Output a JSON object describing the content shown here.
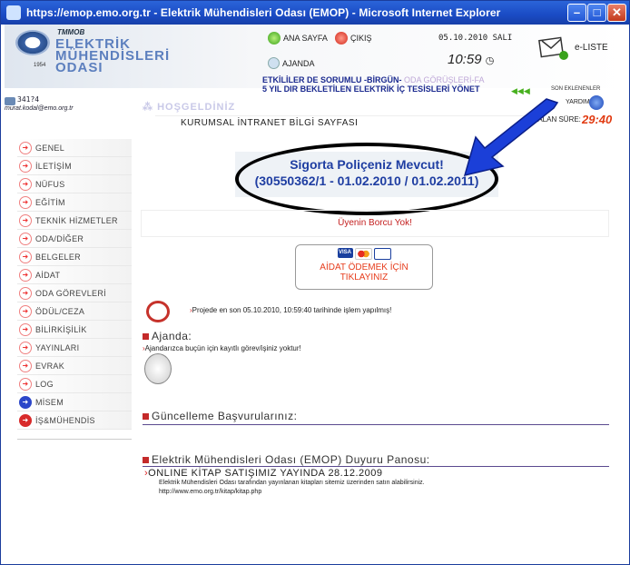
{
  "window": {
    "title": "https://emop.emo.org.tr - Elektrik Mühendisleri Odası (EMOP) - Microsoft Internet Explorer",
    "buttons": {
      "minimize": "–",
      "maximize": "□",
      "close": "✕"
    }
  },
  "header": {
    "logo": {
      "top": "TMMOB",
      "line1": "ELEKTRİK",
      "line2": "MÜHENDİSLERİ",
      "line3": "ODASI",
      "year": "1954"
    },
    "nav": {
      "home": "ANA SAYFA",
      "logout": "ÇIKIŞ",
      "agenda": "AJANDA"
    },
    "date": "05.10.2010 SALI",
    "time": "10:59",
    "eliste": "e-LISTE"
  },
  "user": {
    "id": "341?4",
    "email": "murat.kodal@emo.org.tr"
  },
  "ticker": {
    "line1": "ETKİLİLER DE SORUMLU -BİRGÜN-",
    "line1_faded": "ODA GÖRÜŞLERİ-FA",
    "line2": "5 YIL DIR BEKLETİLEN ELEKTRİK İÇ TESİSLERİ YÖNET"
  },
  "son_eklenenler": "SON EKLENENLER",
  "yardim": "YARDIM",
  "welcome": "HOŞGELDİNİZ",
  "intranet_title": "KURUMSAL İNTRANET BİLGİ SAYFASI",
  "kalan_sure": {
    "label": "KALAN SÜRE:",
    "value": "29:40"
  },
  "sidebar": {
    "items": [
      {
        "label": "GENEL"
      },
      {
        "label": "İLETİŞİM"
      },
      {
        "label": "NÜFUS"
      },
      {
        "label": "EĞİTİM"
      },
      {
        "label": "TEKNİK HİZMETLER"
      },
      {
        "label": "ODA/DİĞER"
      },
      {
        "label": "BELGELER"
      },
      {
        "label": "AİDAT"
      },
      {
        "label": "ODA GÖREVLERİ"
      },
      {
        "label": "ÖDÜL/CEZA"
      },
      {
        "label": "BİLİRKİŞİLİK"
      },
      {
        "label": "YAYINLARI"
      },
      {
        "label": "EVRAK"
      },
      {
        "label": "LOG"
      },
      {
        "label": "MİSEM"
      },
      {
        "label": "İŞ&MÜHENDİS"
      }
    ]
  },
  "policy": {
    "line1": "Sigorta Poliçeniz Mevcut!",
    "line2": "(30550362/1 - 01.02.2010 / 01.02.2011)"
  },
  "borcu": "Üyenin Borcu Yok!",
  "aidat_button": {
    "line1": "AİDAT ÖDEMEK İÇİN",
    "line2": "TIKLAYINIZ",
    "card1": "VISA"
  },
  "project_note": "Projede en son 05.10.2010, 10:59:40 tarihinde işlem yapılmış!",
  "ajanda": {
    "title": "Ajanda:",
    "note": "Ajandarızca buçün için kayıtlı görev/işiniz yoktur!"
  },
  "guncelleme": {
    "title": "Güncelleme Başvurularınız:"
  },
  "duyuru": {
    "title": "Elektrik Mühendisleri Odası (EMOP) Duyuru Panosu:",
    "item_title": "ONLINE KİTAP SATIŞIMIZ YAYINDA 28.12.2009",
    "item_body": "Elektrik Mühendisleri Odası tarafından yayınlanan kitapları sitemiz üzerinden satın alabilirsiniz.",
    "item_link": "http://www.emo.org.tr/kitap/kitap.php"
  }
}
